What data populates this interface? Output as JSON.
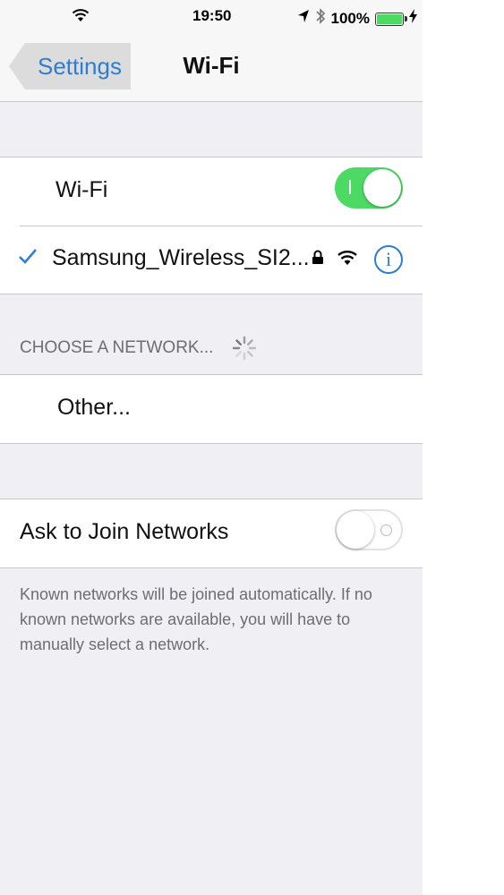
{
  "status_bar": {
    "time": "19:50",
    "battery_percent": "100%",
    "battery_level": 1.0,
    "icons": [
      "wifi-signal-icon",
      "location-arrow-icon",
      "bluetooth-icon",
      "battery-icon",
      "charging-bolt-icon"
    ]
  },
  "nav": {
    "back_label": "Settings",
    "title": "Wi-Fi"
  },
  "wifi_toggle": {
    "label": "Wi-Fi",
    "state": "on"
  },
  "connected_network": {
    "name": "Samsung_Wireless_SI2...",
    "icons": [
      "checkmark-icon",
      "lock-icon",
      "wifi-signal-icon",
      "info-icon"
    ],
    "info_glyph": "i"
  },
  "choose_network": {
    "header": "CHOOSE A NETWORK...",
    "spinner_icon": "activity-spinner-icon",
    "other_label": "Other..."
  },
  "ask_to_join": {
    "label": "Ask to Join Networks",
    "state": "off",
    "footer": "Known networks will be joined automatically. If no known networks are available, you will have to manually select a network."
  },
  "colors": {
    "accent": "#2f7dd1",
    "toggle_on": "#4cd964",
    "background": "#efeff4",
    "secondary_text": "#6d6d72"
  }
}
